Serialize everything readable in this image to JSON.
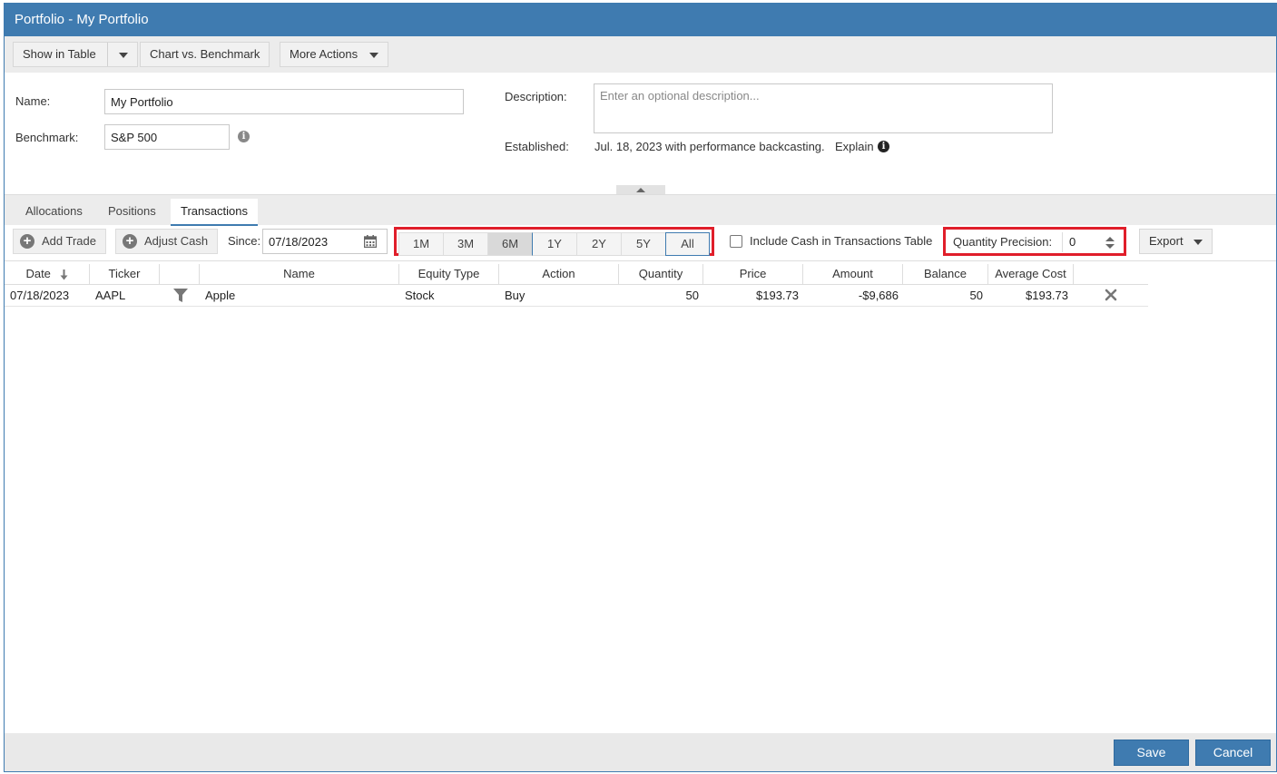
{
  "window": {
    "title": "Portfolio - My Portfolio"
  },
  "toolbar": {
    "show_in_table": "Show in Table",
    "chart_vs_benchmark": "Chart vs. Benchmark",
    "more_actions": "More Actions"
  },
  "properties": {
    "name_label": "Name:",
    "name_value": "My Portfolio",
    "benchmark_label": "Benchmark:",
    "benchmark_value": "S&P 500",
    "description_label": "Description:",
    "description_placeholder": "Enter an optional description...",
    "established_label": "Established:",
    "established_text": "Jul. 18, 2023 with performance backcasting.",
    "explain_label": "Explain"
  },
  "tabs": [
    {
      "label": "Allocations"
    },
    {
      "label": "Positions"
    },
    {
      "label": "Transactions",
      "active": true
    }
  ],
  "actions": {
    "add_trade": "Add Trade",
    "adjust_cash": "Adjust Cash",
    "since_label": "Since:",
    "since_value": "07/18/2023",
    "ranges": [
      "1M",
      "3M",
      "6M",
      "1Y",
      "2Y",
      "5Y",
      "All"
    ],
    "selected_range": "6M",
    "include_cash_label": "Include Cash in Transactions Table",
    "include_cash_checked": false,
    "quantity_precision_label": "Quantity Precision:",
    "quantity_precision_value": "0",
    "export_label": "Export"
  },
  "table": {
    "columns": [
      "Date",
      "Ticker",
      "",
      "Name",
      "Equity Type",
      "Action",
      "Quantity",
      "Price",
      "Amount",
      "Balance",
      "Average Cost"
    ],
    "rows": [
      {
        "date": "07/18/2023",
        "ticker": "AAPL",
        "name": "Apple",
        "equity_type": "Stock",
        "action": "Buy",
        "quantity": "50",
        "price": "$193.73",
        "amount": "-$9,686",
        "balance": "50",
        "average_cost": "$193.73"
      }
    ]
  },
  "footer": {
    "save": "Save",
    "cancel": "Cancel"
  },
  "colors": {
    "accent": "#3f7bb0",
    "highlight": "#e01e2a"
  }
}
